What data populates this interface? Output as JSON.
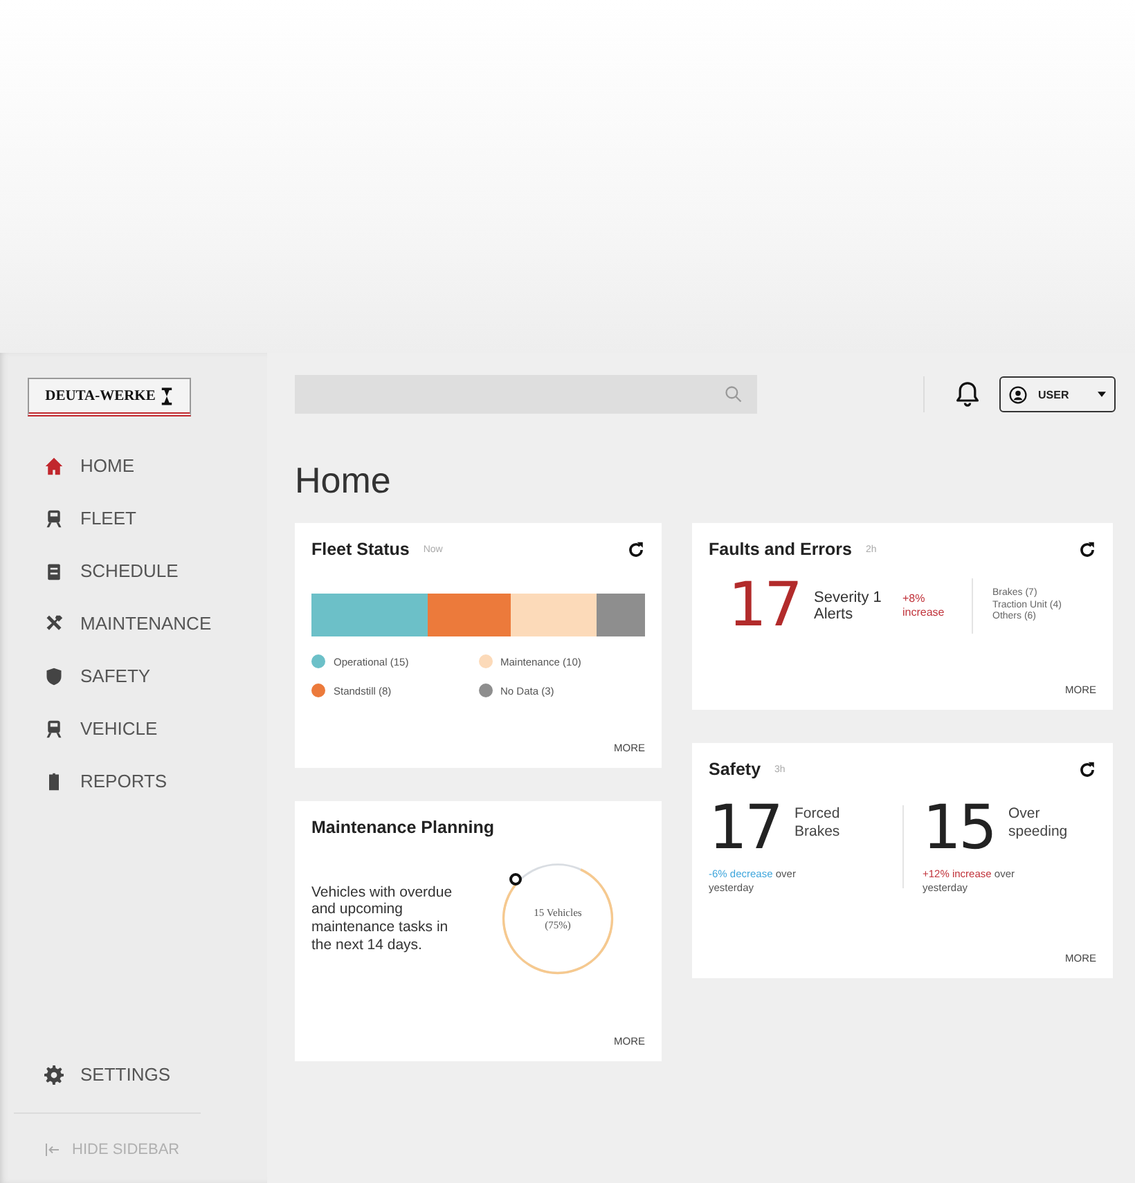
{
  "logo": {
    "text": "DEUTA-WERKE"
  },
  "sidebar": {
    "items": [
      {
        "label": "HOME",
        "selected": true
      },
      {
        "label": "FLEET",
        "selected": false
      },
      {
        "label": "SCHEDULE",
        "selected": false
      },
      {
        "label": "MAINTENANCE",
        "selected": false
      },
      {
        "label": "SAFETY",
        "selected": false
      },
      {
        "label": "VEHICLE",
        "selected": false
      },
      {
        "label": "REPORTS",
        "selected": false
      }
    ],
    "settings": "SETTINGS",
    "hide": "HIDE SIDEBAR"
  },
  "header": {
    "user": "USER"
  },
  "page_title": "Home",
  "fleet_status": {
    "title": "Fleet Status",
    "age": "Now",
    "segments": [
      {
        "color": "#6cc0c8"
      },
      {
        "color": "#ec7a3b"
      },
      {
        "color": "#fcdab9"
      },
      {
        "color": "#8e8e8e"
      }
    ],
    "legend": [
      {
        "label": "Operational (15)",
        "color": "#6cc0c8"
      },
      {
        "label": "Maintenance (10)",
        "color": "#fcdab9"
      },
      {
        "label": "Standstill (8)",
        "color": "#ec7a3b"
      },
      {
        "label": "No Data (3)",
        "color": "#8e8e8e"
      }
    ],
    "more": "MORE"
  },
  "maintenance": {
    "title": "Maintenance Planning",
    "text": "Vehicles with overdue and upcoming maintenance tasks in the next 14 days.",
    "center": "15 Vehicles",
    "center_sub": "(75%)",
    "level": 0.8,
    "more": "MORE"
  },
  "faults": {
    "title": "Faults and Errors",
    "age": "2h",
    "count": "17",
    "label": "Severity 1 Alerts",
    "change": "+8% increase",
    "breakdown": [
      "Brakes (7)",
      "Traction Unit (4)",
      "Others (6)"
    ],
    "more": "MORE"
  },
  "safety": {
    "title": "Safety",
    "age": "3h",
    "items": [
      {
        "count": "17",
        "label": "Forced Brakes",
        "change": "-6% decrease",
        "suffix": "over yesterday",
        "color": "#3fa6dc"
      },
      {
        "count": "15",
        "label": "Over speeding",
        "change": "+12% increase",
        "suffix": "over yesterday",
        "color": "#c0323a"
      }
    ],
    "more": "MORE"
  }
}
